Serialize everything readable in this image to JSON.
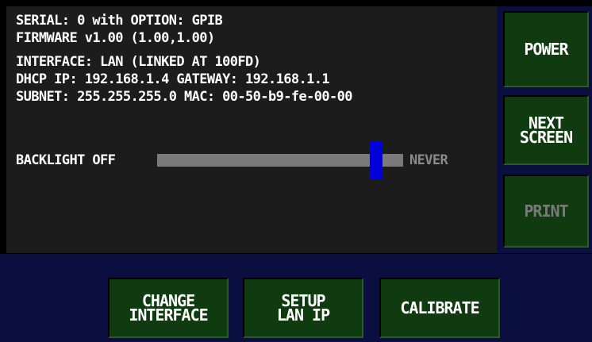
{
  "info": {
    "serial_line": "SERIAL: 0 with OPTION: GPIB",
    "firmware_line": "FIRMWARE v1.00 (1.00,1.00)",
    "interface_line": "INTERFACE: LAN (LINKED AT 100FD)",
    "dhcp_line": "DHCP IP: 192.168.1.4  GATEWAY: 192.168.1.1",
    "subnet_line": "SUBNET: 255.255.255.0  MAC: 00-50-b9-fe-00-00"
  },
  "backlight": {
    "label": "BACKLIGHT OFF",
    "end_label": "NEVER",
    "level": 0.91
  },
  "side_buttons": {
    "power": "POWER",
    "next_screen": "NEXT\nSCREEN",
    "print": "PRINT"
  },
  "bottom_buttons": {
    "change_interface": "CHANGE\nINTERFACE",
    "setup_lan_ip": "SETUP\nLAN IP",
    "calibrate": "CALIBRATE"
  },
  "colors": {
    "button_bg": "#103a10",
    "panel_bg": "#1c1c1c",
    "nav_bg": "#0b0f3f",
    "slider_thumb": "#0000d8",
    "slider_track": "#7a7a7a",
    "disabled_text": "#7a7a7a"
  }
}
